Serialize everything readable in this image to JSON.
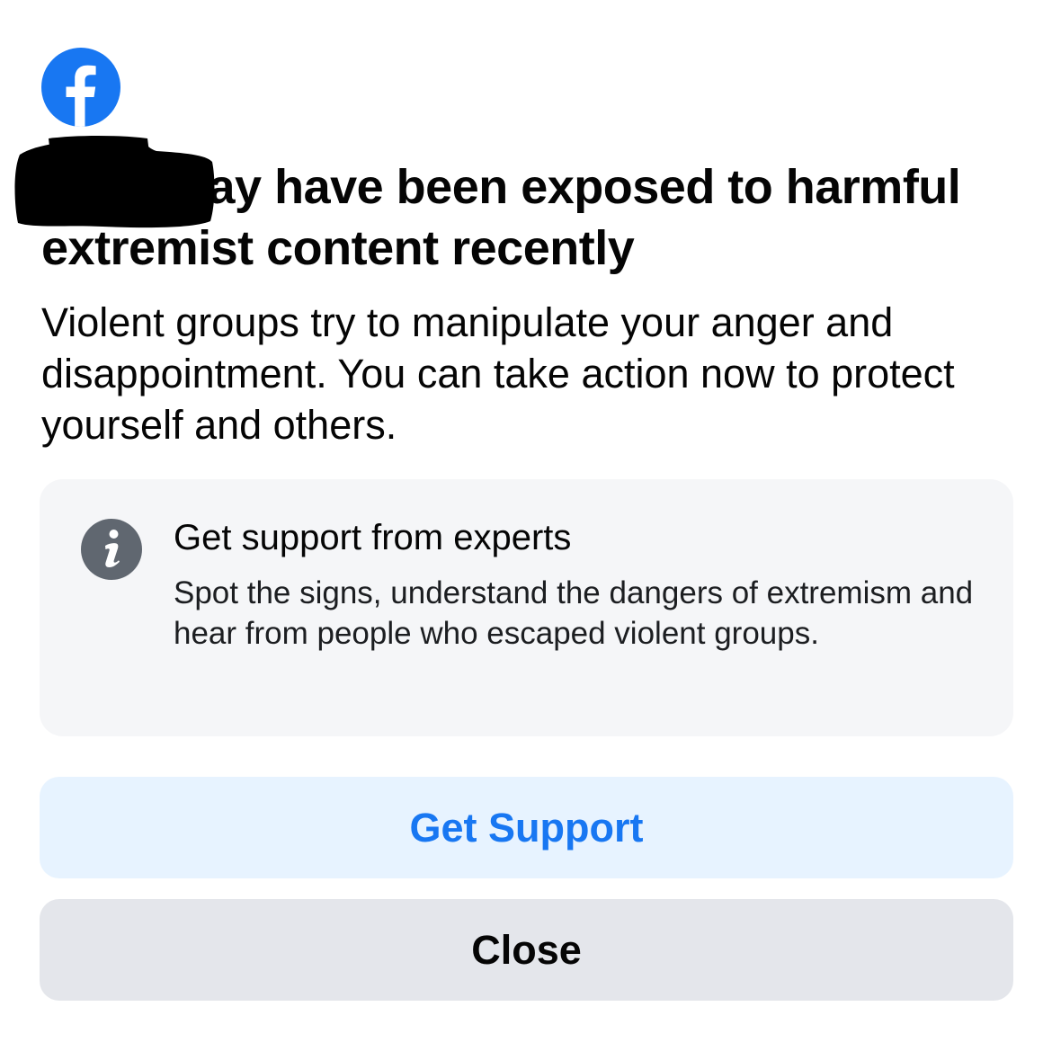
{
  "brand": {
    "logo_icon": "facebook-logo-icon",
    "brand_color": "#1877F2"
  },
  "headline": {
    "redacted_name": "",
    "text": ", you may have been exposed to harmful extremist content recently"
  },
  "body": {
    "text": "Violent groups try to manipulate your anger and disappointment. You can take action now to protect yourself and others."
  },
  "support_card": {
    "icon": "info-icon",
    "title": "Get support from experts",
    "description": "Spot the signs, understand the dangers of extremism and hear from people who escaped violent groups."
  },
  "actions": {
    "primary_label": "Get Support",
    "secondary_label": "Close"
  },
  "colors": {
    "primary_button_bg": "#E7F3FF",
    "primary_button_text": "#1877F2",
    "secondary_button_bg": "#E4E6EB",
    "card_bg": "#F5F6F8",
    "info_icon": "#606770"
  }
}
